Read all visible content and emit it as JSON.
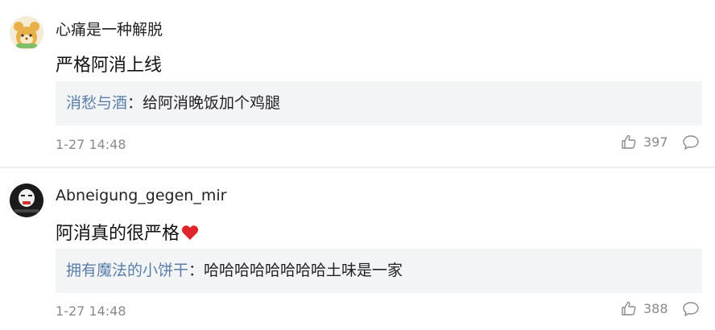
{
  "comments": [
    {
      "username": "心痛是一种解脱",
      "text": "严格阿消上线",
      "reply": {
        "name": "消愁与酒",
        "sep": "：",
        "text": "给阿消晚饭加个鸡腿"
      },
      "time": "1-27 14:48",
      "likes": "397"
    },
    {
      "username": "Abneigung_gegen_mir",
      "text": "阿消真的很严格",
      "reply": {
        "name": "拥有魔法的小饼干",
        "sep": "：",
        "text": "哈哈哈哈哈哈哈哈土味是一家"
      },
      "time": "1-27 14:48",
      "likes": "388"
    }
  ],
  "icons": {
    "like": "thumbs-up-icon",
    "reply": "comment-bubble-icon",
    "heart": "heart-icon"
  },
  "colors": {
    "reply_name": "#5a7ea8",
    "reply_bg": "#f3f4f6",
    "meta": "#8a8a8a",
    "heart": "#e0262b"
  }
}
